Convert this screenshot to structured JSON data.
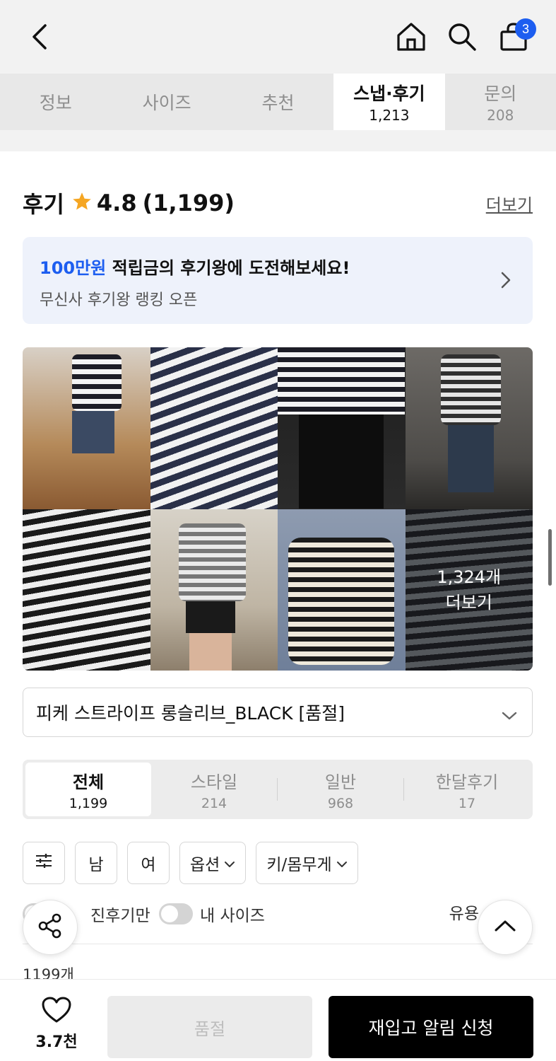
{
  "header": {
    "cart_badge": "3",
    "icons": [
      "chevron-left-icon",
      "home-icon",
      "search-icon",
      "shopping-bag-icon"
    ]
  },
  "tabs": [
    {
      "label": "정보",
      "count": ""
    },
    {
      "label": "사이즈",
      "count": ""
    },
    {
      "label": "추천",
      "count": ""
    },
    {
      "label": "스냅·후기",
      "count": "1,213"
    },
    {
      "label": "문의",
      "count": "208"
    }
  ],
  "active_tab": "스냅·후기",
  "review": {
    "title": "후기",
    "rating": "4.8",
    "count": "(1,199)",
    "more": "더보기"
  },
  "banner": {
    "accent": "100만원",
    "line1_rest": " 적립금의 후기왕에 도전해보세요!",
    "line2": "무신사 후기왕 랭킹 오픈"
  },
  "photos": {
    "more_count": "1,324개",
    "more_label": "더보기"
  },
  "option_select": {
    "value": "피케 스트라이프 롱슬리브_BLACK [품절]"
  },
  "segments": [
    {
      "label": "전체",
      "count": "1,199"
    },
    {
      "label": "스타일",
      "count": "214"
    },
    {
      "label": "일반",
      "count": "968"
    },
    {
      "label": "한달후기",
      "count": "17"
    }
  ],
  "filters": {
    "male": "남",
    "female": "여",
    "option": "옵션",
    "height_weight": "키/몸무게"
  },
  "toggles": {
    "photo_only": "사진후기만",
    "photo_only_visible": "진후기만",
    "my_size": "내 사이즈",
    "sort": "유용"
  },
  "list_count": "1199개",
  "bottom_bar": {
    "like_count": "3.7천",
    "soldout": "품절",
    "restock": "재입고 알림 신청"
  },
  "colors": {
    "accent_blue": "#1d5ef0",
    "star": "#f5a623",
    "cta_black": "#000000"
  }
}
